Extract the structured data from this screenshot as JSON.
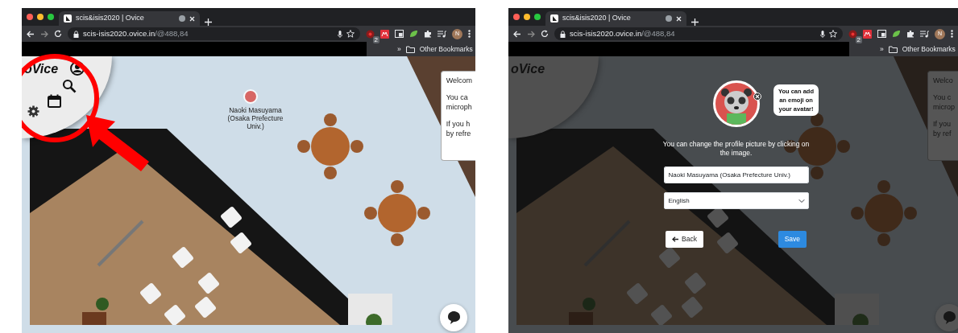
{
  "browsers": [
    {
      "tab": {
        "title": "scis&isis2020 | Ovice"
      },
      "address": {
        "host": "scis-isis2020.ovice.in",
        "path": "/@488,84"
      },
      "extension_badge": "2",
      "profile_initial": "N",
      "bookmarks": {
        "overflow": "»",
        "folder": "Other Bookmarks"
      },
      "page": {
        "kind": "map",
        "logo": "oVice",
        "avatar_label": "Naoki Masuyama (Osaka Prefecture Univ.)",
        "welcome_lines": [
          "Welcom",
          "You ca",
          "microph",
          "If you h",
          "by refre"
        ],
        "annotation": true
      }
    },
    {
      "tab": {
        "title": "scis&isis2020 | Ovice"
      },
      "address": {
        "host": "scis-isis2020.ovice.in",
        "path": "/@488,84"
      },
      "extension_badge": "2",
      "profile_initial": "N",
      "bookmarks": {
        "overflow": "»",
        "folder": "Other Bookmarks"
      },
      "page": {
        "kind": "profile",
        "logo": "oVice",
        "welcome_lines": [
          "Welco",
          "You c",
          "microp",
          "If you",
          "by ref"
        ],
        "dialog": {
          "tooltip": "You can add an emoji on your avatar!",
          "hint": "You can change the profile picture by clicking on the image.",
          "name_value": "Naoki Masuyama (Osaka Prefecture Univ.)",
          "language": "English",
          "back": "Back",
          "save": "Save"
        }
      }
    }
  ]
}
